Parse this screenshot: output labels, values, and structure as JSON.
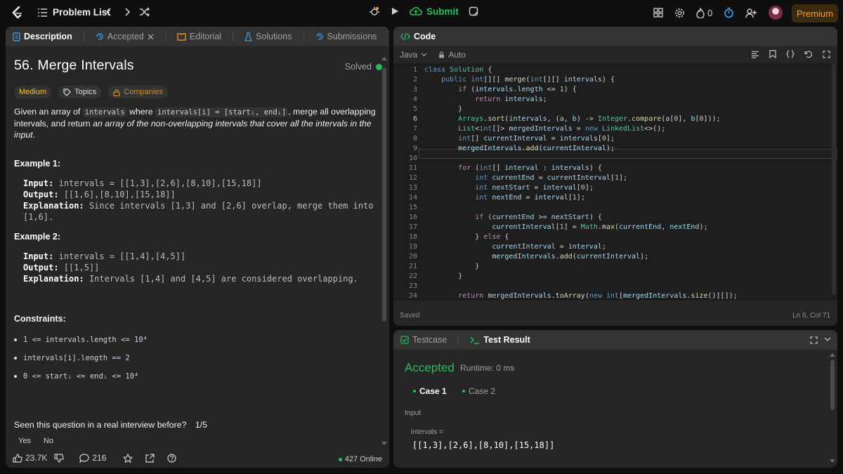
{
  "topbar": {
    "problem_list": "Problem List",
    "submit": "Submit",
    "streak": "0",
    "premium": "Premium"
  },
  "left_tabs": [
    {
      "label": "Description"
    },
    {
      "label": "Accepted"
    },
    {
      "label": "Editorial"
    },
    {
      "label": "Solutions"
    },
    {
      "label": "Submissions"
    }
  ],
  "problem": {
    "title": "56. Merge Intervals",
    "status": "Solved",
    "difficulty": "Medium",
    "topics": "Topics",
    "companies": "Companies",
    "desc_1": "Given an array of",
    "desc_code_1": "intervals",
    "desc_2": "where",
    "desc_code_2": "intervals[i] = [startᵢ, endᵢ]",
    "desc_3": ", merge all overlapping intervals,",
    "desc_4": "and return",
    "desc_5": "an array of the non-overlapping intervals that cover all the intervals in the input",
    "desc_6": "."
  },
  "examples": [
    {
      "heading": "Example 1:",
      "input": "intervals = [[1,3],[2,6],[8,10],[15,18]]",
      "output": "[[1,6],[8,10],[15,18]]",
      "explanation": "Since intervals [1,3] and [2,6] overlap, merge them into",
      "explanation2": "[1,6]."
    },
    {
      "heading": "Example 2:",
      "input": "intervals = [[1,4],[4,5]]",
      "output": "[[1,5]]",
      "explanation": "Intervals [1,4] and [4,5] are considered overlapping."
    }
  ],
  "labels": {
    "input": "Input:",
    "output": "Output:",
    "explanation": "Explanation:"
  },
  "constraints": {
    "heading": "Constraints:",
    "items": [
      "1 <= intervals.length <= 10⁴",
      "intervals[i].length == 2",
      "0 <= startᵢ <= endᵢ <= 10⁴"
    ]
  },
  "interview": {
    "question": "Seen this question in a real interview before?",
    "count": "1/5",
    "yes": "Yes",
    "no": "No"
  },
  "footer": {
    "likes": "23.7K",
    "comments": "216",
    "online": "427 Online"
  },
  "code": {
    "tab": "Code",
    "language": "Java",
    "mode": "Auto",
    "saved": "Saved",
    "cursor": "Ln 6, Col 71",
    "line_numbers": [
      "1",
      "2",
      "3",
      "4",
      "5",
      "6",
      "7",
      "8",
      "9",
      "10",
      "11",
      "12",
      "13",
      "14",
      "15",
      "16",
      "17",
      "18",
      "19",
      "20",
      "21",
      "22",
      "23",
      "24"
    ]
  },
  "tests": {
    "tab_testcase": "Testcase",
    "tab_result": "Test Result",
    "result": "Accepted",
    "runtime": "Runtime: 0 ms",
    "case1": "Case 1",
    "case2": "Case 2",
    "input_label": "Input",
    "var_label": "intervals =",
    "var_value": "[[1,3],[2,6],[8,10],[15,18]]"
  },
  "colors": {
    "accent": "#ffa116",
    "green": "#2cbb5d",
    "bg": "#0f0f0f",
    "panel": "#262626"
  }
}
